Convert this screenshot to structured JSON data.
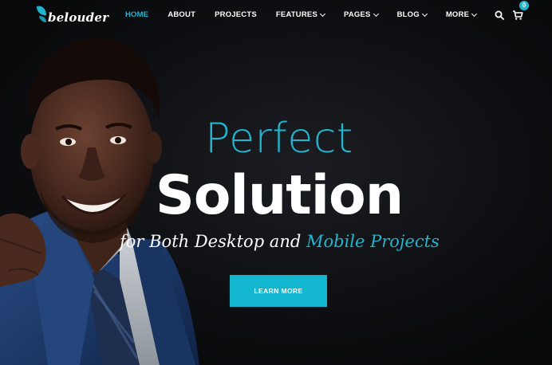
{
  "brand": {
    "name": "belouder",
    "accent_color": "#21b5cf"
  },
  "nav": {
    "items": [
      {
        "label": "HOME",
        "active": true,
        "has_dropdown": false
      },
      {
        "label": "ABOUT",
        "active": false,
        "has_dropdown": false
      },
      {
        "label": "PROJECTS",
        "active": false,
        "has_dropdown": false
      },
      {
        "label": "FEATURES",
        "active": false,
        "has_dropdown": true
      },
      {
        "label": "PAGES",
        "active": false,
        "has_dropdown": true
      },
      {
        "label": "BLOG",
        "active": false,
        "has_dropdown": true
      },
      {
        "label": "MORE",
        "active": false,
        "has_dropdown": true
      }
    ],
    "search_icon": "search-icon",
    "cart_icon": "cart-icon",
    "cart_count": "0"
  },
  "hero": {
    "line1": "Perfect",
    "line2": "Solution",
    "line3_prefix": "for Both Desktop and ",
    "line3_accent": "Mobile Projects",
    "cta_label": "LEARN MORE"
  }
}
